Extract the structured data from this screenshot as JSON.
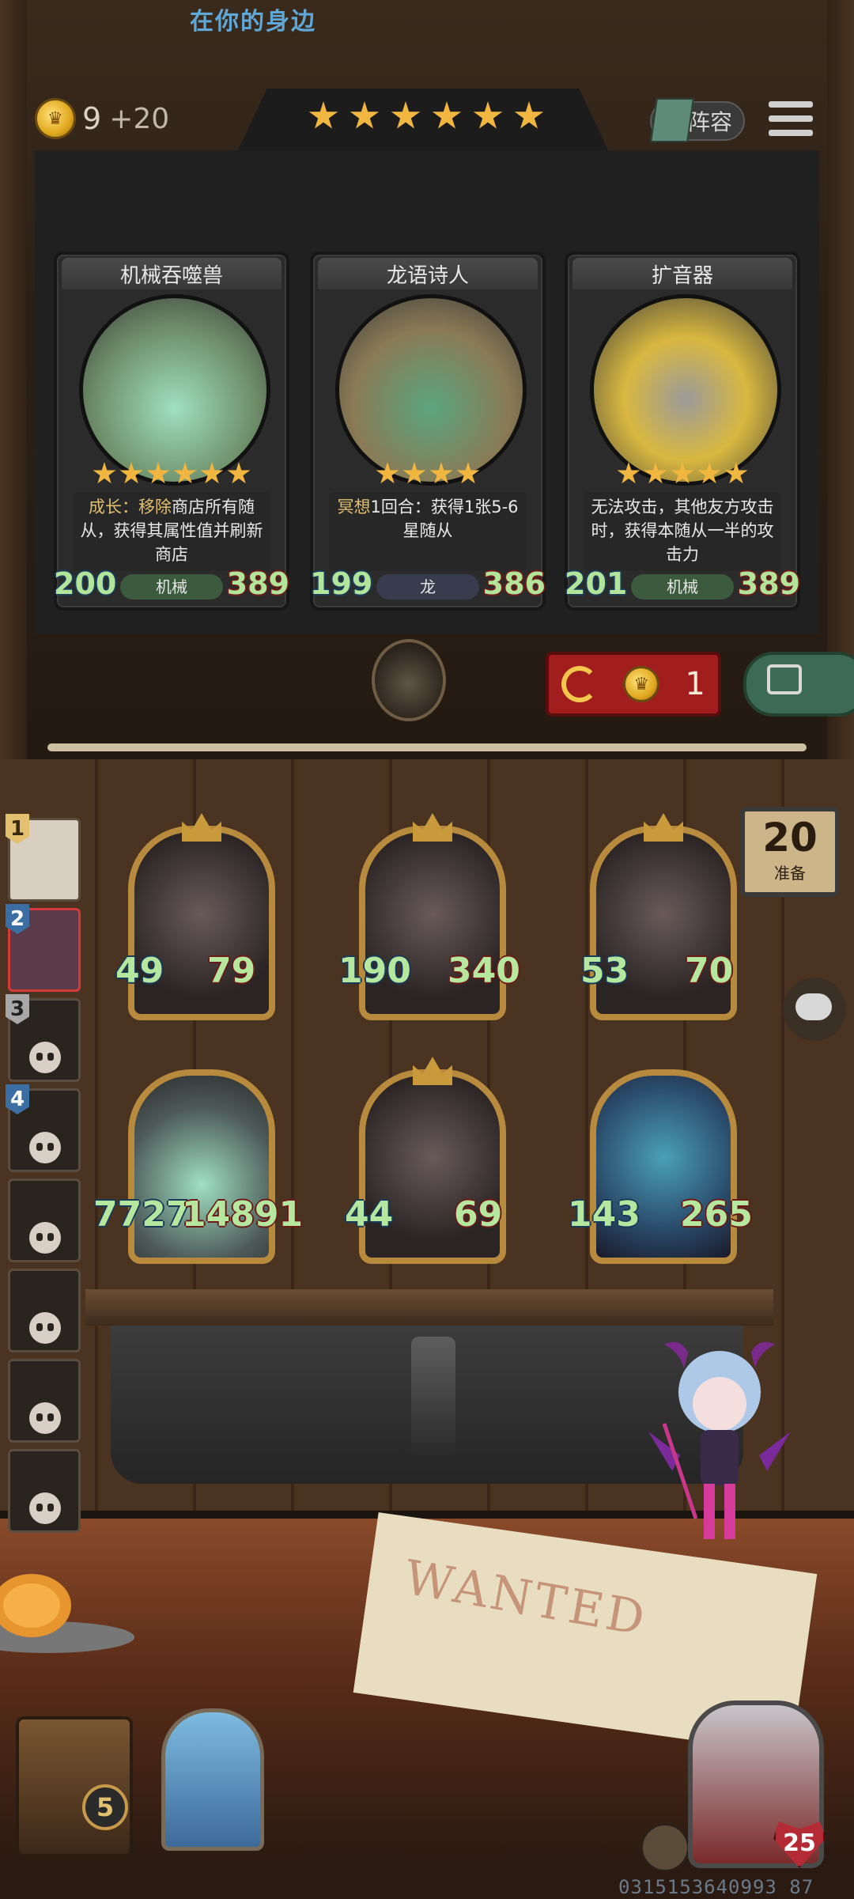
{
  "header": {
    "subtitle": "在你的身边",
    "gold": "9",
    "gold_income": "+20",
    "tavern_tier_stars": 6,
    "lineup_label": "阵容"
  },
  "shop": {
    "cards": [
      {
        "name": "机械吞噬兽",
        "stars": 6,
        "description_keyword": "成长：移除",
        "description": "商店所有随从，获得其属性值并刷新商店",
        "attack": "200",
        "health": "389",
        "tribe": "机械",
        "portrait_color": "#6f8f6a"
      },
      {
        "name": "龙语诗人",
        "stars": 4,
        "description_keyword": "冥想",
        "description": "1回合：获得1张5-6星随从",
        "attack": "199",
        "health": "386",
        "tribe": "龙",
        "portrait_color": "#8a7a55"
      },
      {
        "name": "扩音器",
        "stars": 5,
        "description_keyword": "",
        "description": "无法攻击，其他友方攻击时，获得本随从一半的攻击力",
        "attack": "201",
        "health": "389",
        "tribe": "机械",
        "portrait_color": "#d9b840"
      }
    ],
    "refresh_cost": "1"
  },
  "roster": {
    "slots": [
      {
        "rank": "1",
        "state": "alive"
      },
      {
        "rank": "2",
        "state": "alive"
      },
      {
        "rank": "3",
        "state": "dead"
      },
      {
        "rank": "4",
        "state": "dead"
      },
      {
        "rank": "",
        "state": "dead"
      },
      {
        "rank": "",
        "state": "dead"
      },
      {
        "rank": "",
        "state": "dead"
      },
      {
        "rank": "",
        "state": "dead"
      }
    ]
  },
  "board": {
    "units": [
      {
        "attack": "49",
        "health": "79"
      },
      {
        "attack": "190",
        "health": "340"
      },
      {
        "attack": "53",
        "health": "70"
      },
      {
        "attack": "7727",
        "health": "14891"
      },
      {
        "attack": "44",
        "health": "69"
      },
      {
        "attack": "143",
        "health": "265"
      }
    ]
  },
  "prep": {
    "timer": "20",
    "label": "准备"
  },
  "bottom": {
    "wanted_text": "WANTED",
    "chest_count": "5",
    "hero_health": "25",
    "game_id": "0315153640993 87"
  },
  "colors": {
    "stat_green": "#b6e79e",
    "refresh_red": "#a21d1d",
    "lock_green": "#3d6a54",
    "gold": "#e0a81e"
  }
}
